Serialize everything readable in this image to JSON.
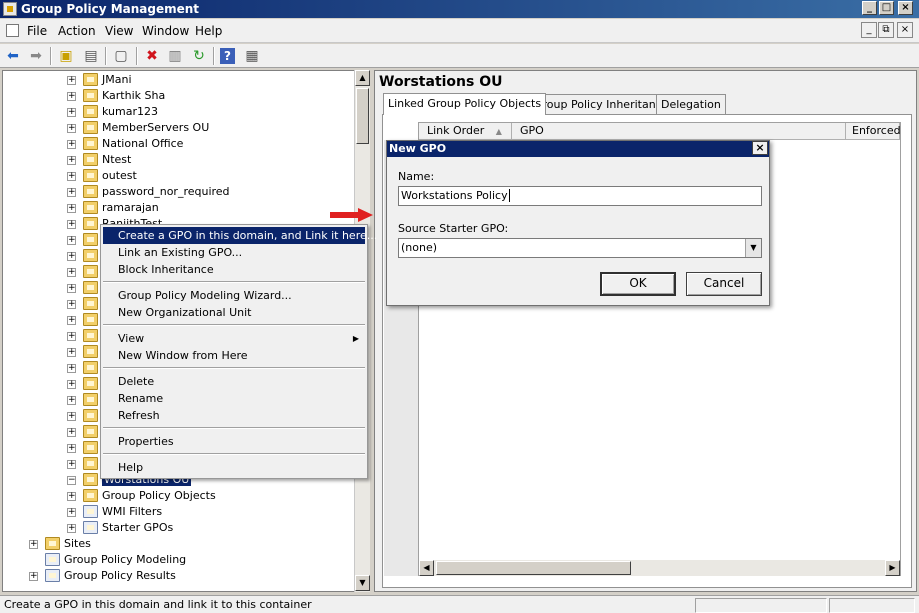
{
  "window": {
    "title": "Group Policy Management"
  },
  "menubar": {
    "items": [
      "File",
      "Action",
      "View",
      "Window",
      "Help"
    ]
  },
  "toolbar": {
    "icons": [
      "back-arrow-icon",
      "forward-arrow-icon",
      "up-folder-icon",
      "show-hide-tree-icon",
      "clipboard-icon",
      "delete-icon",
      "properties-icon",
      "refresh-icon",
      "help-icon",
      "console-icon"
    ]
  },
  "tree": {
    "ou_items": [
      "JMani",
      "Karthik Sha",
      "kumar123",
      "MemberServers OU",
      "National Office",
      "Ntest",
      "outest",
      "password_nor_required",
      "ramarajan",
      "RanjithTest"
    ],
    "selected": "Worstations OU",
    "domain_children": [
      "Group Policy Objects",
      "WMI Filters",
      "Starter GPOs"
    ],
    "root_items": [
      "Sites",
      "Group Policy Modeling",
      "Group Policy Results"
    ]
  },
  "context_menu": {
    "items": [
      {
        "label": "Create a GPO in this domain, and Link it here...",
        "highlighted": true
      },
      {
        "label": "Link an Existing GPO..."
      },
      {
        "label": "Block Inheritance"
      },
      {
        "label": "Group Policy Modeling Wizard..."
      },
      {
        "label": "New Organizational Unit"
      },
      {
        "label": "View",
        "submenu": true
      },
      {
        "label": "New Window from Here"
      },
      {
        "label": "Delete"
      },
      {
        "label": "Rename"
      },
      {
        "label": "Refresh"
      },
      {
        "label": "Properties"
      },
      {
        "label": "Help"
      }
    ]
  },
  "right_pane": {
    "title": "Worstations OU",
    "tabs": [
      "Linked Group Policy Objects",
      "Group Policy Inheritance",
      "Delegation"
    ],
    "active_tab": "Linked Group Policy Objects",
    "columns": [
      "Link Order",
      "GPO",
      "Enforced"
    ]
  },
  "dialog": {
    "title": "New GPO",
    "name_label": "Name:",
    "name_value": "Workstations Policy",
    "starter_label": "Source Starter GPO:",
    "starter_value": "(none)",
    "ok_label": "OK",
    "cancel_label": "Cancel"
  },
  "statusbar": {
    "text": "Create a GPO in this domain and link it to this container"
  },
  "colors": {
    "titlebar": "#0a246a",
    "highlight": "#0a246a",
    "folder": "#f2cf69",
    "arrow": "#e02020"
  }
}
